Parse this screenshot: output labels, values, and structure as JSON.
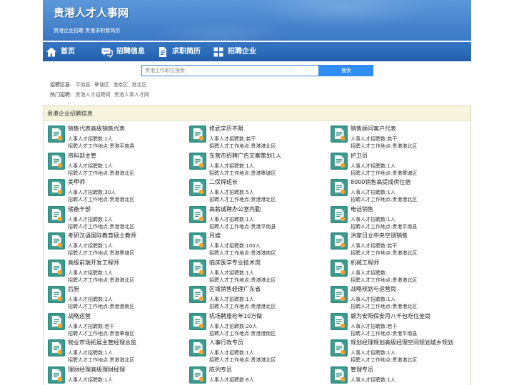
{
  "site": {
    "title": "贵港人才人事网",
    "subtitle": "贵港企业招聘 贵港求职看简历"
  },
  "nav": [
    {
      "label": "首页",
      "icon": "home-icon"
    },
    {
      "label": "招聘信息",
      "icon": "chat-icon"
    },
    {
      "label": "求职简历",
      "icon": "document-icon"
    },
    {
      "label": "招聘企业",
      "icon": "grid-icon"
    }
  ],
  "search": {
    "placeholder": "贵港工作职位搜索",
    "button_label": "搜索"
  },
  "filters": {
    "districts_label": "招聘区县:",
    "districts": [
      "平南县",
      "覃塘区",
      "港南区",
      "港北区"
    ],
    "hot_label": "热门招聘:",
    "hot": [
      "贵港人才招聘网",
      "贵港人事人才网"
    ]
  },
  "section": {
    "title": "贵港企业招聘信息",
    "count_label": "人事人才招聘数:",
    "location_label": "招聘人才工作地点:",
    "jobs": [
      {
        "title": "销售代表高级销售代表",
        "count": "1人",
        "location": "贵港平南县"
      },
      {
        "title": "修武学历不限",
        "count": "若干",
        "location": "贵港港北区"
      },
      {
        "title": "销售顾问客户代表",
        "count": "若干",
        "location": "贵港港北区"
      },
      {
        "title": "资料部主管",
        "count": "1人",
        "location": "贵港港北区"
      },
      {
        "title": "东营市招聘广告文案策划1人",
        "count": "1人",
        "location": "贵港覃塘区"
      },
      {
        "title": "护卫员",
        "count": "1人",
        "location": "贵港覃塘区"
      },
      {
        "title": "美甲师",
        "count": "30人",
        "location": "贵港港北区"
      },
      {
        "title": "二保焊班长",
        "count": "5人",
        "location": "贵港港北区"
      },
      {
        "title": "8000销售高提成供住宿",
        "count": "1人",
        "location": "贵港港北区"
      },
      {
        "title": "储备干部",
        "count": "1人",
        "location": "贵港港北区"
      },
      {
        "title": "高薪诚聘办公室内勤",
        "count": "1人",
        "location": "贵港平南县"
      },
      {
        "title": "电话销售",
        "count": "1人",
        "location": "贵港平南县"
      },
      {
        "title": "考研汉语国际教育硕士教师",
        "count": "1人",
        "location": "贵港覃塘区"
      },
      {
        "title": "月嫂",
        "count": "100人",
        "location": "贵港港南区"
      },
      {
        "title": "洪家日立中央空调销售",
        "count": "若干",
        "location": "贵港港北区"
      },
      {
        "title": "高级前端开发工程师",
        "count": "1人",
        "location": "贵港港北区"
      },
      {
        "title": "临床医学专业技术岗",
        "count": "1人",
        "location": "贵港港北区"
      },
      {
        "title": "机械工程师",
        "location": "贵港港北区"
      },
      {
        "title": "后厨",
        "count": "1人",
        "location": "贵港港南区"
      },
      {
        "title": "区域销售经理广东省",
        "count": "1人",
        "location": "贵港港北区"
      },
      {
        "title": "战略规划与运营岗",
        "count": "1人",
        "location": "贵港港北区"
      },
      {
        "title": "战略运营",
        "count": "若干",
        "location": "贵港覃塘区"
      },
      {
        "title": "机场聘旅检年10万做",
        "count": "20人",
        "location": "贵港港南区"
      },
      {
        "title": "赣为安阳保安月八千包吃住坐岗",
        "count": "若干",
        "location": "贵港平南县"
      },
      {
        "title": "物业市场拓展主管经理总监",
        "count": "1人",
        "location": "贵港港北区"
      },
      {
        "title": "人事行政专员",
        "count": "1人",
        "location": "贵港港北区"
      },
      {
        "title": "规划经理规划高级经理空间规划城乡规划",
        "count": "1人",
        "location": "贵港港北区"
      },
      {
        "title": "理财经理高级理财经理",
        "count": "1人"
      },
      {
        "title": "陈列专员",
        "count": "6人"
      },
      {
        "title": "管理专员",
        "count": "1人"
      }
    ]
  },
  "colors": {
    "header": "#3b78c4",
    "nav": "#2a69b6",
    "search_button": "#2f8cf0",
    "section_header": "#f7f4dd",
    "icon": "#2a8c80"
  }
}
